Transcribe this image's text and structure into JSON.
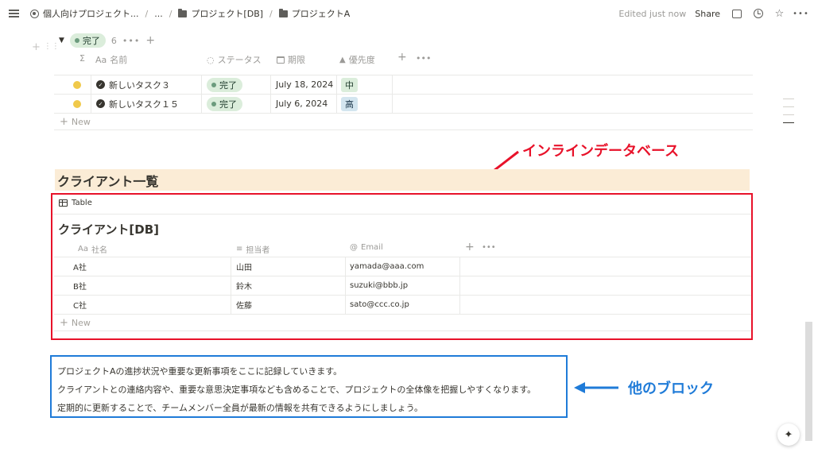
{
  "topbar": {
    "crumbs": [
      "個人向けプロジェクト...",
      "...",
      "プロジェクト[DB]",
      "プロジェクトA"
    ],
    "edited": "Edited just now",
    "share": "Share"
  },
  "group": {
    "status": "完了",
    "count": "6",
    "more": "•••"
  },
  "task_table": {
    "columns": [
      "Σ",
      "名前",
      "ステータス",
      "期限",
      "優先度"
    ],
    "col_prefix": {
      "name": "Aa"
    },
    "rows": [
      {
        "name": "新しいタスク３",
        "status": "完了",
        "due": "July 18, 2024",
        "priority": "中"
      },
      {
        "name": "新しいタスク１５",
        "status": "完了",
        "due": "July 6, 2024",
        "priority": "高"
      }
    ],
    "new_label": "New",
    "add": "+",
    "more": "•••"
  },
  "annotations": {
    "red": "インラインデータベース",
    "blue": "他のブロック"
  },
  "section_heading": "クライアント一覧",
  "client_db": {
    "view_tab": "Table",
    "title": "クライアント[DB]",
    "columns": [
      "社名",
      "担当者",
      "Email"
    ],
    "col_prefix": {
      "name": "Aa",
      "email": "@"
    },
    "rows": [
      {
        "company": "A社",
        "person": "山田",
        "email": "yamada@aaa.com"
      },
      {
        "company": "B社",
        "person": "鈴木",
        "email": "suzuki@bbb.jp"
      },
      {
        "company": "C社",
        "person": "佐藤",
        "email": "sato@ccc.co.jp"
      }
    ],
    "new_label": "New",
    "add": "+",
    "more": "•••"
  },
  "paragraphs": [
    "プロジェクトAの進捗状況や重要な更新事項をここに記録していきます。",
    "クライアントとの連絡内容や、重要な意思決定事項なども含めることで、プロジェクトの全体像を把握しやすくなります。",
    "定期的に更新することで、チームメンバー全員が最新の情報を共有できるようにしましょう。"
  ],
  "colors": {
    "annotation_red": "#e8122a",
    "annotation_blue": "#1f7bd8",
    "heading_bg": "#fbecd6",
    "tag_green": "#dbeddb",
    "tag_blue": "#d3e5ef"
  }
}
